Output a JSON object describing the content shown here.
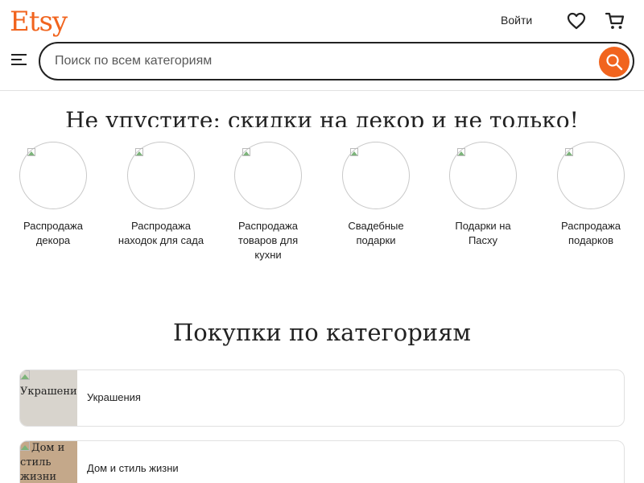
{
  "brand": {
    "logo_text": "Etsy",
    "accent_color": "#f1641e"
  },
  "header": {
    "signin_label": "Войти",
    "favorites_icon": "heart-icon",
    "cart_icon": "cart-icon",
    "menu_icon": "hamburger-menu-icon"
  },
  "search": {
    "placeholder": "Поиск по всем категориям",
    "button_icon": "search-icon"
  },
  "deals": {
    "title": "Не упустите: скидки на декор и не только!",
    "items": [
      {
        "label": "Распродажа декора"
      },
      {
        "label": "Распродажа находок для сада"
      },
      {
        "label": "Распродажа товаров для кухни"
      },
      {
        "label": "Свадебные подарки"
      },
      {
        "label": "Подарки на Пасху"
      },
      {
        "label": "Распродажа подарков"
      }
    ]
  },
  "categories": {
    "title": "Покупки по категориям",
    "items": [
      {
        "label": "Украшения",
        "image_alt": "Украшения",
        "thumb_color": "#d8d4cd"
      },
      {
        "label": "Дом и стиль жизни",
        "image_alt": "Дом и стиль жизни",
        "thumb_color": "#c4a88a"
      }
    ]
  }
}
